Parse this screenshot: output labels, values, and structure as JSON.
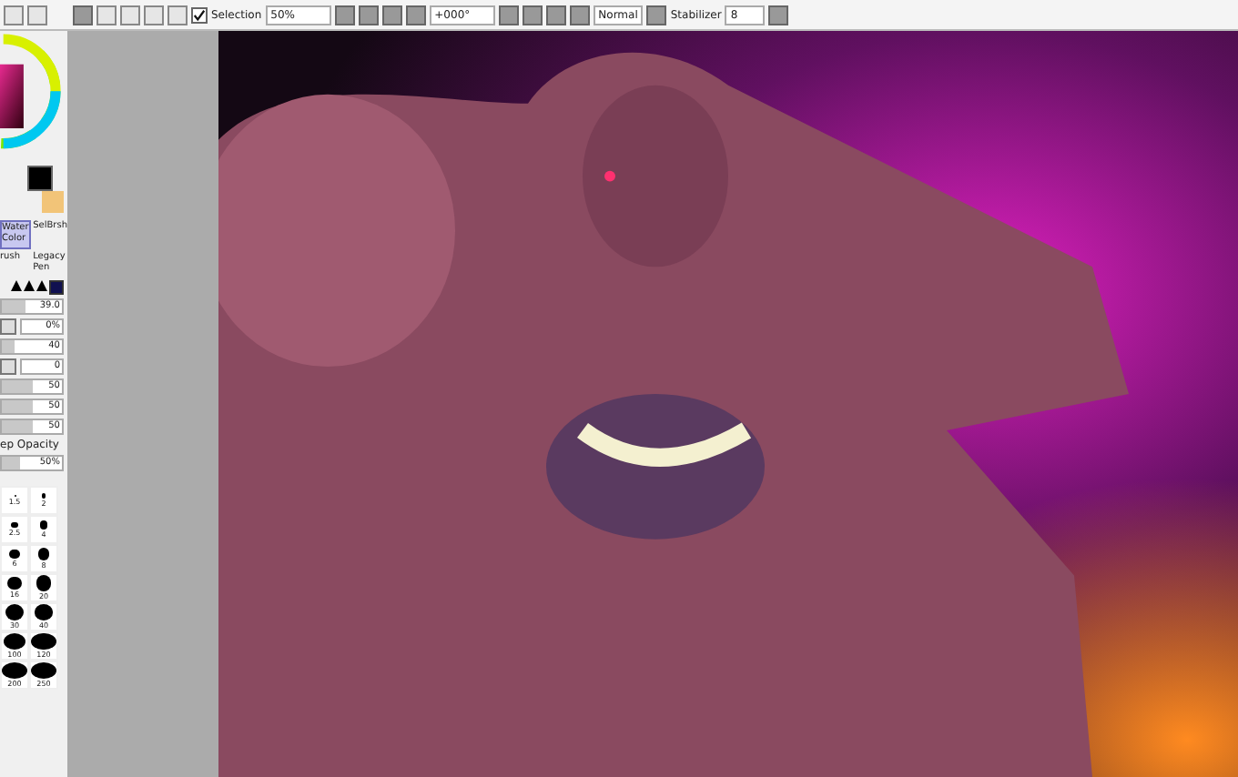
{
  "toolbar": {
    "selection": {
      "label": "Selection",
      "checked": true
    },
    "zoom": "50%",
    "rotation": "+000°",
    "blend_mode": "Normal",
    "stabilizer": {
      "label": "Stabilizer",
      "value": "8"
    }
  },
  "tools": [
    {
      "label": "Water Color",
      "selected": true
    },
    {
      "label": "SelBrsh",
      "selected": false
    },
    {
      "label": "rush",
      "selected": false
    },
    {
      "label": "Legacy Pen",
      "selected": false
    }
  ],
  "sliders": [
    {
      "kind": "slider",
      "value": "39.0",
      "level": 0.4
    },
    {
      "kind": "field",
      "value": "0%"
    },
    {
      "kind": "slider",
      "value": "40",
      "level": 0.2
    },
    {
      "kind": "field",
      "value": "0"
    },
    {
      "kind": "slider",
      "value": "50",
      "level": 0.5
    },
    {
      "kind": "slider",
      "value": "50",
      "level": 0.5
    },
    {
      "kind": "slider",
      "value": "50",
      "level": 0.5
    }
  ],
  "keep_opacity": {
    "label": "ep Opacity",
    "value": "50%",
    "level": 0.3
  },
  "brush_sizes": [
    {
      "label": "1.5",
      "selected": false
    },
    {
      "label": "2",
      "selected": false
    },
    {
      "label": "2.5",
      "selected": false
    },
    {
      "label": "4",
      "selected": false
    },
    {
      "label": "6",
      "selected": false
    },
    {
      "label": "8",
      "selected": false
    },
    {
      "label": "16",
      "selected": false
    },
    {
      "label": "20",
      "selected": false
    },
    {
      "label": "30",
      "selected": false
    },
    {
      "label": "40",
      "selected": false
    },
    {
      "label": "100",
      "selected": false
    },
    {
      "label": "120",
      "selected": false
    },
    {
      "label": "200",
      "selected": false
    },
    {
      "label": "250",
      "selected": false
    }
  ]
}
